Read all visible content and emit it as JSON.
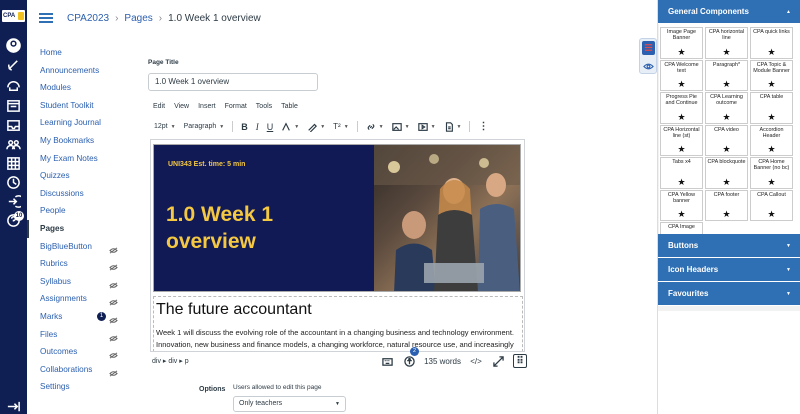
{
  "global_nav": {
    "logo_text": "CPA",
    "icons": [
      "account-icon",
      "dashboard-icon",
      "courses-icon",
      "calendar-icon",
      "inbox-icon",
      "groups-icon",
      "grid-icon",
      "commons-icon",
      "history-icon",
      "login-icon",
      "help-icon"
    ],
    "help_badge": "10"
  },
  "breadcrumb": {
    "course": "CPA2023",
    "section": "Pages",
    "current": "1.0 Week 1 overview"
  },
  "course_nav": {
    "items": [
      {
        "label": "Home"
      },
      {
        "label": "Announcements"
      },
      {
        "label": "Modules"
      },
      {
        "label": "Student Toolkit"
      },
      {
        "label": "Learning Journal"
      },
      {
        "label": "My Bookmarks"
      },
      {
        "label": "My Exam Notes"
      },
      {
        "label": "Quizzes"
      },
      {
        "label": "Discussions"
      },
      {
        "label": "People"
      },
      {
        "label": "Pages",
        "active": true
      },
      {
        "label": "BigBlueButton",
        "hidden": true
      },
      {
        "label": "Rubrics",
        "hidden": true
      },
      {
        "label": "Syllabus",
        "hidden": true
      },
      {
        "label": "Assignments",
        "hidden": true
      },
      {
        "label": "Marks",
        "hidden": true,
        "count": "1"
      },
      {
        "label": "Files",
        "hidden": true
      },
      {
        "label": "Outcomes",
        "hidden": true
      },
      {
        "label": "Collaborations",
        "hidden": true
      },
      {
        "label": "Settings"
      }
    ]
  },
  "editor": {
    "page_title_label": "Page Title",
    "page_title_value": "1.0  Week 1 overview",
    "menu": [
      "Edit",
      "View",
      "Insert",
      "Format",
      "Tools",
      "Table"
    ],
    "font_size": "12pt",
    "block_format": "Paragraph",
    "banner": {
      "subtitle": "UNI343 Est. time: 5 min",
      "title": "1.0 Week 1 overview"
    },
    "heading": "The future accountant",
    "paragraph": "Week 1 will discuss the evolving role of the accountant in a changing business and technology environment. Innovation, new business and finance models, a changing workforce, natural resource use, and increasingly",
    "element_path": "div ▸ div ▸ p",
    "a11y_badge": "2",
    "word_count": "135 words"
  },
  "options": {
    "label": "Options",
    "users_label": "Users allowed to edit this page",
    "selected": "Only teachers"
  },
  "panel": {
    "sections": {
      "general": "General Components",
      "buttons": "Buttons",
      "icon_headers": "Icon Headers",
      "favourites": "Favourites"
    },
    "tiles": [
      "Image Page Banner",
      "CPA horizontal line",
      "CPA quick links",
      "CPA Welcome text",
      "Paragraph*",
      "CPA Topic & Module Banner",
      "Progress Pie and Continue",
      "CPA Learning outcome",
      "CPA table",
      "CPA Horizontal line (st)",
      "CPA video",
      "Accordion Header",
      "Tabs x4",
      "CPA blockquote",
      "CPA Home Banner (no bc)",
      "CPA Yellow banner",
      "CPA footer",
      "CPA Callout",
      "CPA Image"
    ],
    "star": "★"
  },
  "colors": {
    "global_nav_bg": "#0f1f54",
    "accent": "#2f6fb3",
    "banner_bg": "#121a56",
    "banner_text": "#f5c842"
  }
}
